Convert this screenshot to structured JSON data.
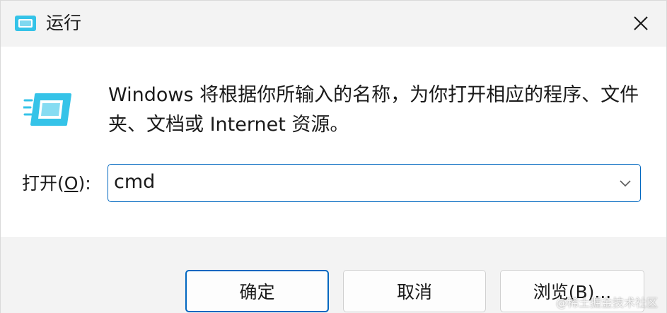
{
  "window": {
    "title": "运行",
    "close_icon": "close-icon",
    "run_icon": "run-app-icon"
  },
  "content": {
    "description": "Windows 将根据你所输入的名称，为你打开相应的程序、文件夹、文档或 Internet 资源。",
    "open_label_prefix": "打开(",
    "open_label_mnemonic": "O",
    "open_label_suffix": "):",
    "command_value": "cmd",
    "dropdown_icon": "chevron-down-icon"
  },
  "buttons": {
    "ok": "确定",
    "cancel": "取消",
    "browse": "浏览(B)..."
  },
  "watermark": "@稀土掘金技术社区",
  "colors": {
    "accent": "#0067c0",
    "titlebar_bg": "#f3f3f3",
    "content_bg": "#ffffff",
    "icon_cyan": "#35c3e8"
  }
}
